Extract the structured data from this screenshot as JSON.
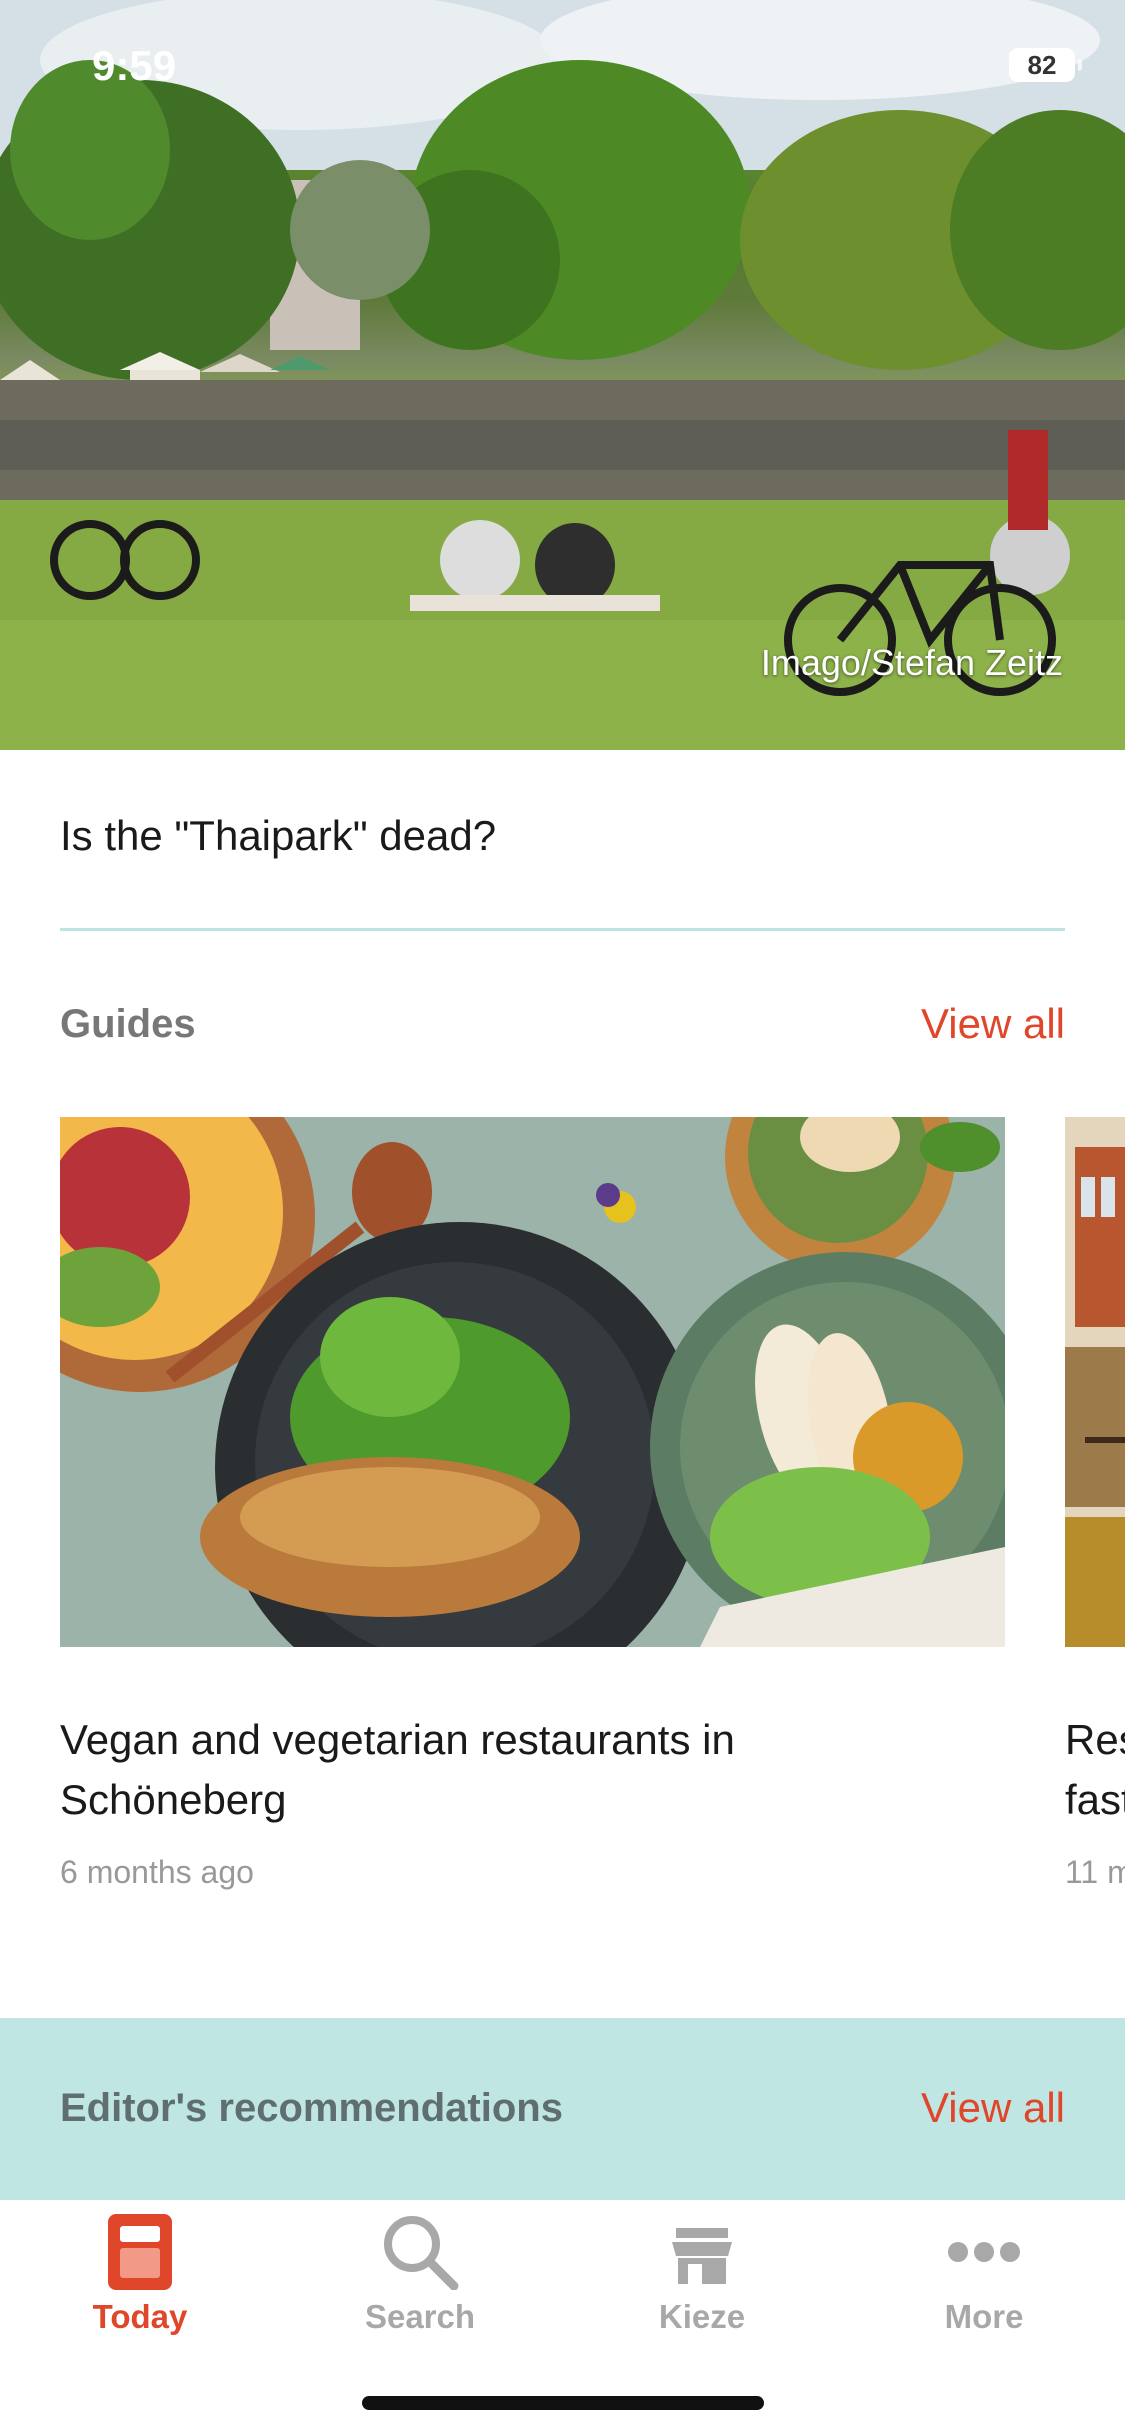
{
  "status_bar": {
    "time": "9:59",
    "battery": "82"
  },
  "hero": {
    "credit": "Imago/Stefan Zeitz"
  },
  "article": {
    "title": "Is the \"Thaipark\" dead?"
  },
  "guides": {
    "title": "Guides",
    "view_all": "View all",
    "cards": [
      {
        "title_line1": "Vegan and vegetarian restaurants in",
        "title_line2": "Schöneberg",
        "meta": "6 months ago"
      },
      {
        "title_line1": "Res",
        "title_line2": "fast",
        "meta": "11 m"
      }
    ]
  },
  "recommendations": {
    "title": "Editor's recommendations",
    "view_all": "View all"
  },
  "tabbar": {
    "items": [
      {
        "label": "Today",
        "icon": "newspaper-icon",
        "active": true
      },
      {
        "label": "Search",
        "icon": "search-icon",
        "active": false
      },
      {
        "label": "Kieze",
        "icon": "storefront-icon",
        "active": false
      },
      {
        "label": "More",
        "icon": "more-dots-icon",
        "active": false
      }
    ]
  },
  "colors": {
    "accent": "#e0462a",
    "band": "#c0e6e4",
    "divider": "#bfe3e3",
    "inactive": "#a8a8a8"
  }
}
